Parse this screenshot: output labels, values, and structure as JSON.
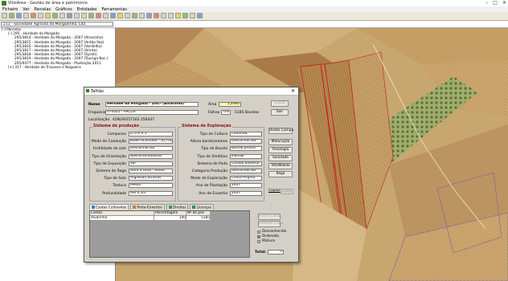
{
  "window": {
    "title": "VitisArea - Gestão de área e património"
  },
  "menu": [
    "Ficheiro",
    "Ver",
    "Parcelas",
    "Gráficos",
    "Entidades",
    "Ferramentas"
  ],
  "company": {
    "value": "211 - Sociedade Agrícola da Morgadinha, Lda"
  },
  "tree": [
    {
      "label": "Parcelas",
      "indent": 0,
      "expander": "-"
    },
    {
      "label": "295 - Herdade da Morgada",
      "indent": 1,
      "expander": "-"
    },
    {
      "label": "295/3814 - Herdade da Morgada - 2007 (Alvarinho)",
      "indent": 2,
      "expander": ""
    },
    {
      "label": "295/3815 - Herdade da Morgada - 2007 (Antão Vaz)",
      "indent": 2,
      "expander": ""
    },
    {
      "label": "295/3816 - Herdade da Morgada - 2007 (Verdelho)",
      "indent": 2,
      "expander": ""
    },
    {
      "label": "295/3817 - Herdade da Morgada - 2007 (Arinto)",
      "indent": 2,
      "expander": ""
    },
    {
      "label": "295/3818 - Herdade da Morgada - 2007 (Syrah)",
      "indent": 2,
      "expander": ""
    },
    {
      "label": "295/3819 - Herdade da Morgada - 2007 (Touriga Nac.)",
      "indent": 2,
      "expander": ""
    },
    {
      "label": "295/0477 - Herdade da Morgada - Plantação 2011",
      "indent": 2,
      "expander": ""
    },
    {
      "label": "317 - Herdade de Travasos e Nogueira",
      "indent": 1,
      "expander": "+"
    }
  ],
  "dialog": {
    "title": "Talhão",
    "nome_label": "Nome",
    "nome_value": "Herdade da Morgada - 2007 (Alvarinho)",
    "area_label": "Área",
    "area_value": "1,2960",
    "guardar": "Gravar",
    "sair": "Sair",
    "freguesia_label": "Freguesia",
    "freguesia_value": "070401 - ARCOS",
    "falhas_label": "Falhas",
    "falhas_value": "0%",
    "bacelos_value": "5185  Bacelos",
    "localizacao_label": "Localização:",
    "localizacao_value": "42N29/257163 256447",
    "producao": {
      "title": "Sistema de produção",
      "rows": [
        {
          "label": "Compasso",
          "value": "2,5 m  x  1"
        },
        {
          "label": "Modo de Condução",
          "value": "Baixo Acamado - 50,70cm"
        },
        {
          "label": "Fertilidade do solo",
          "value": "Desconhecida"
        },
        {
          "label": "Tipo de Orientação",
          "value": "Nascente/Sudeste"
        },
        {
          "label": "Tipo de Exposição",
          "value": "Sul"
        },
        {
          "label": "Sistema de Rega",
          "value": "Gota a Gota - Aérea"
        },
        {
          "label": "Tipo de Solo",
          "value": "Argiloso/Calcários"
        },
        {
          "label": "Textura",
          "value": "Média"
        },
        {
          "label": "Profundidade",
          "value": "Até 0,5m"
        }
      ]
    },
    "exploracao": {
      "title": "Sistema de Exploração",
      "rows": [
        {
          "label": "Tipo de Cultura",
          "value": "Contínua"
        },
        {
          "label": "Altura bardo/arames",
          "value": "Desconhecida"
        },
        {
          "label": "Tipo de Bacelo",
          "value": "Bacelo pronto"
        },
        {
          "label": "Tipo de Vinditivo",
          "value": "Manual"
        },
        {
          "label": "Sistema de Poda",
          "value": "Cordão Bilateral"
        },
        {
          "label": "Categoria Produção",
          "value": "Desconhecido"
        },
        {
          "label": "Modo de Exploração",
          "value": "Conta Própria"
        },
        {
          "label": "Ano de Plantação",
          "value": "2007"
        },
        {
          "label": "Ano de Enxertia",
          "value": "2007"
        }
      ]
    },
    "side_buttons": [
      "Dados Campo",
      "Maturação",
      "Fenologia",
      "Sanidade",
      "VitisMobile",
      "Rega"
    ],
    "copiar": "Copiar",
    "colar": "Colar",
    "tabs": [
      "Castas Cultivadas",
      "Porta-Enxertos",
      "Direitos",
      "Licenças"
    ],
    "grid": {
      "headers": [
        "Castas",
        "Percentagem",
        "Nº de pés"
      ],
      "rows": [
        [
          "Alvarinho",
          "100",
          "5185"
        ]
      ]
    },
    "inserir": "Inserir Linha",
    "eliminar": "Eliminar Linha",
    "radios": [
      {
        "label": "Desconhecido",
        "on": false
      },
      {
        "label": "Ordenado",
        "on": true
      },
      {
        "label": "Mistura",
        "on": false
      }
    ],
    "total_label": "Total:",
    "total_value": "0"
  }
}
